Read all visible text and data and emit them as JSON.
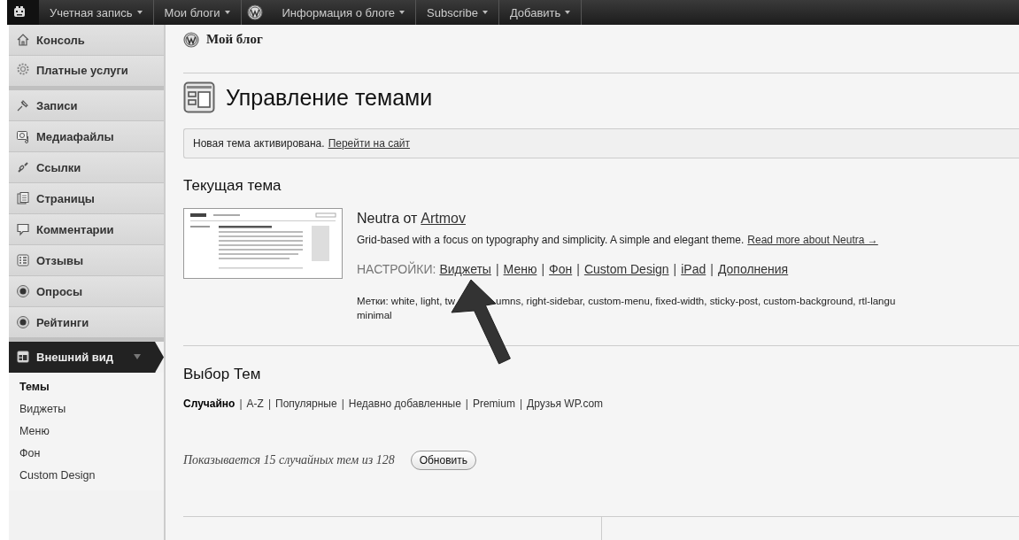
{
  "admin_bar": {
    "items": [
      {
        "kind": "logo"
      },
      {
        "kind": "menu",
        "label": "Учетная запись",
        "dropdown": true
      },
      {
        "kind": "menu",
        "label": "Мои блоги",
        "dropdown": true
      },
      {
        "kind": "logo"
      },
      {
        "kind": "menu",
        "label": "Информация о блоге",
        "dropdown": true
      },
      {
        "kind": "menu",
        "label": "Subscribe",
        "dropdown": true
      },
      {
        "kind": "menu",
        "label": "Добавить",
        "dropdown": true
      }
    ]
  },
  "sidebar": {
    "items": [
      {
        "label": "Консоль",
        "selected": false,
        "group_end": false
      },
      {
        "label": "Платные услуги",
        "selected": false,
        "group_end": true
      },
      {
        "label": "Записи",
        "selected": false,
        "group_end": false
      },
      {
        "label": "Медиафайлы",
        "selected": false,
        "group_end": false
      },
      {
        "label": "Ссылки",
        "selected": false,
        "group_end": false
      },
      {
        "label": "Страницы",
        "selected": false,
        "group_end": false
      },
      {
        "label": "Комментарии",
        "selected": false,
        "group_end": false
      },
      {
        "label": "Отзывы",
        "selected": false,
        "group_end": false
      },
      {
        "label": "Опросы",
        "selected": false,
        "group_end": false
      },
      {
        "label": "Рейтинги",
        "selected": false,
        "group_end": true
      },
      {
        "label": "Внешний вид",
        "selected": true,
        "group_end": false,
        "expanded": true,
        "children": [
          {
            "label": "Темы",
            "selected": true
          },
          {
            "label": "Виджеты",
            "selected": false
          },
          {
            "label": "Меню",
            "selected": false
          },
          {
            "label": "Фон",
            "selected": false
          },
          {
            "label": "Custom Design",
            "selected": false
          }
        ]
      }
    ]
  },
  "site_title": "Мой блог",
  "page_title": "Управление темами",
  "notice": {
    "text": "Новая тема активирована.",
    "link": "Перейти на сайт"
  },
  "current_theme": {
    "heading": "Текущая тема",
    "name": "Neutra от",
    "author": "Artmov",
    "description": "Grid-based with a focus on typography and simplicity. A simple and elegant theme.",
    "read_more": "Read more about Neutra →",
    "settings_label": "НАСТРОЙКИ:",
    "settings_links": [
      {
        "label": "Виджеты"
      },
      {
        "separator": "|",
        "label": "Меню"
      },
      {
        "separator": "|",
        "label": "Фон"
      },
      {
        "separator": "|",
        "label": "Custom Design"
      },
      {
        "separator": "|",
        "label": "iPad"
      },
      {
        "separator": "|",
        "label": "Дополнения"
      }
    ],
    "tags_parts": [
      "Метки: white, light, tw",
      "umns, right-sidebar, custom-menu, fixed-width, sticky-post, custom-background, rtl-langu"
    ],
    "tags_line2": "minimal"
  },
  "theme_browser": {
    "heading": "Выбор Тем",
    "filters": [
      {
        "label": "Случайно",
        "selected": true
      },
      {
        "separator": "|",
        "label": "A-Z",
        "selected": false
      },
      {
        "separator": "|",
        "label": "Популярные",
        "selected": false
      },
      {
        "separator": "|",
        "label": "Недавно добавленные",
        "selected": false
      },
      {
        "separator": "|",
        "label": "Premium",
        "selected": false
      },
      {
        "separator": "|",
        "label": "Друзья WP.com",
        "selected": false
      }
    ],
    "showing": "Показывается 15 случайных тем из 128",
    "refresh_button": "Обновить"
  }
}
